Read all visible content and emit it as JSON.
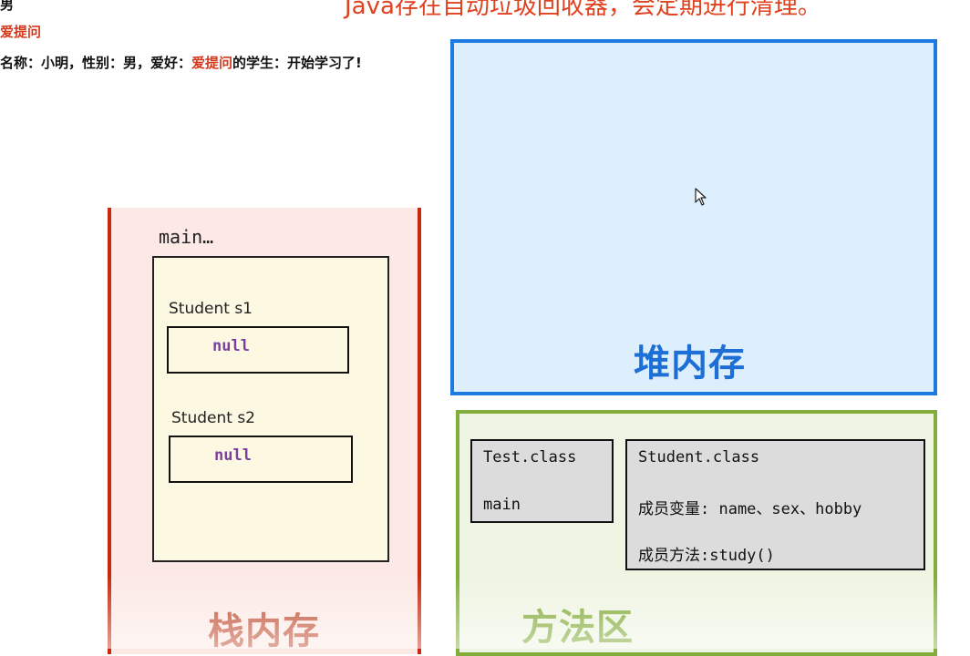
{
  "console": {
    "line1": "男",
    "line2": "爱提问",
    "line3_prefix": "名称：小明，性别：男，爱好：",
    "line3_highlight": "爱提问",
    "line3_suffix": "的学生：开始学习了!"
  },
  "banner": "Java存在自动垃圾回收器，会定期进行清理。",
  "stack": {
    "frame_label": "main…",
    "vars": [
      {
        "label": "Student  s1",
        "value": "null"
      },
      {
        "label": "Student s2",
        "value": "null"
      }
    ],
    "title": "栈内存"
  },
  "heap": {
    "title": "堆内存"
  },
  "method_area": {
    "title": "方法区",
    "test_class": {
      "name": "Test.class",
      "member": "main"
    },
    "student_class": {
      "name": "Student.class",
      "fields": "成员变量: name、sex、hobby",
      "methods": "成员方法:study()"
    }
  },
  "colors": {
    "stack_border": "#c72a10",
    "heap_border": "#1d7ae0",
    "method_border": "#82ad3b",
    "null_text": "#7b3fa0",
    "highlight": "#d6381c"
  },
  "icons": [
    "mouse-pointer-icon"
  ]
}
